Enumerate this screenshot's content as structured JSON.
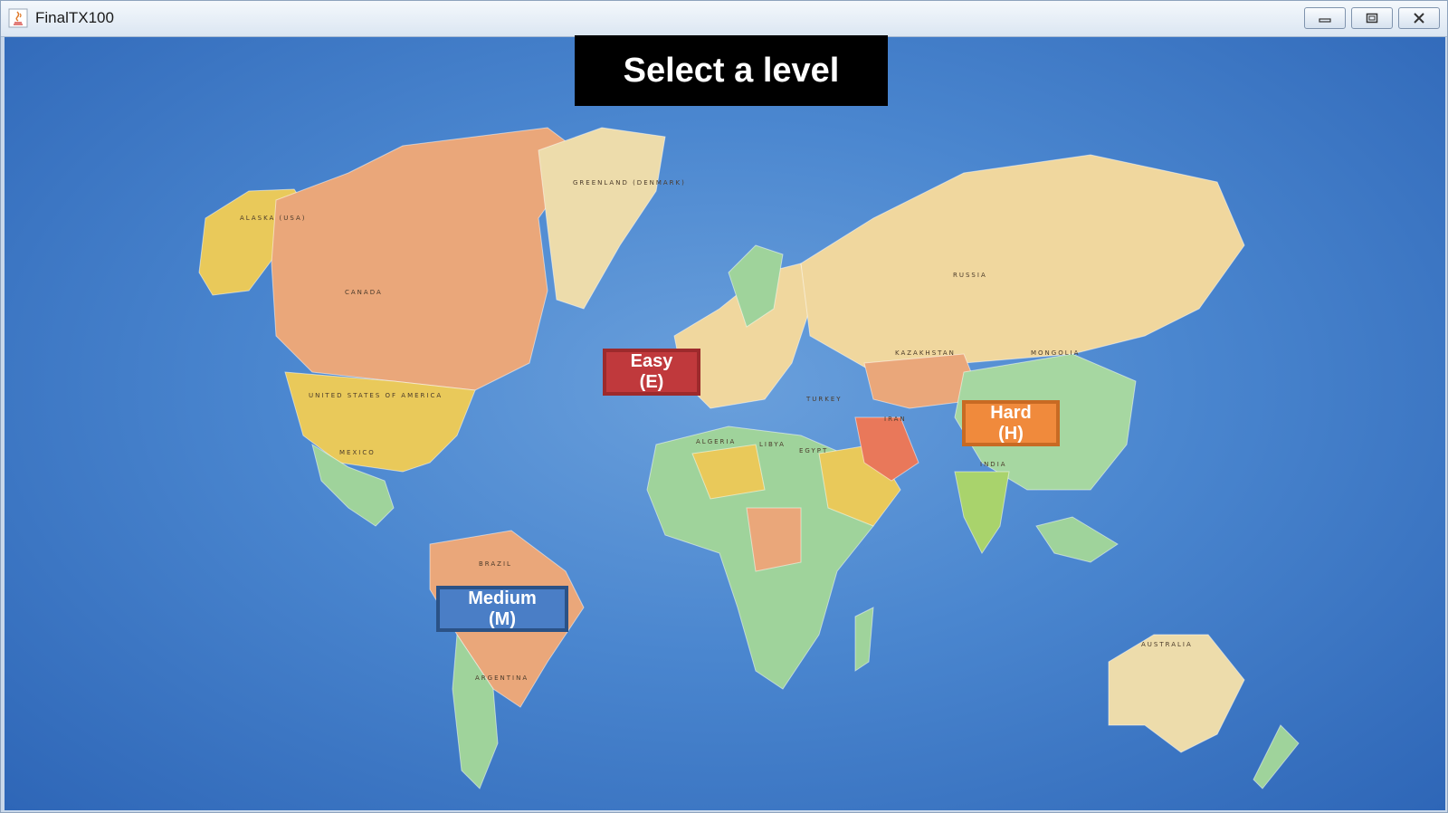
{
  "window": {
    "title": "FinalTX100",
    "icon": "java-icon",
    "controls": [
      "minimize-icon",
      "maximize-icon",
      "close-icon"
    ]
  },
  "screen": {
    "heading": "Select a level"
  },
  "levels": [
    {
      "label": "Easy",
      "key": "(E)",
      "color": "#c0393c"
    },
    {
      "label": "Medium",
      "key": "(M)",
      "color": "#4a7ec6"
    },
    {
      "label": "Hard",
      "key": "(H)",
      "color": "#f08a3c"
    }
  ],
  "map": {
    "ocean_color": "#4a86cf",
    "labels": {
      "canada": "CANADA",
      "usa": "UNITED STATES OF AMERICA",
      "alaska": "ALASKA (USA)",
      "greenland": "GREENLAND (DENMARK)",
      "mexico": "MEXICO",
      "brazil": "BRAZIL",
      "argentina": "ARGENTINA",
      "russia": "RUSSIA",
      "kazakhstan": "KAZAKHSTAN",
      "mongolia": "MONGOLIA",
      "india": "INDIA",
      "iran": "IRAN",
      "turkey": "TURKEY",
      "algeria": "ALGERIA",
      "libya": "LIBYA",
      "egypt": "EGYPT",
      "australia": "AUSTRALIA"
    }
  }
}
